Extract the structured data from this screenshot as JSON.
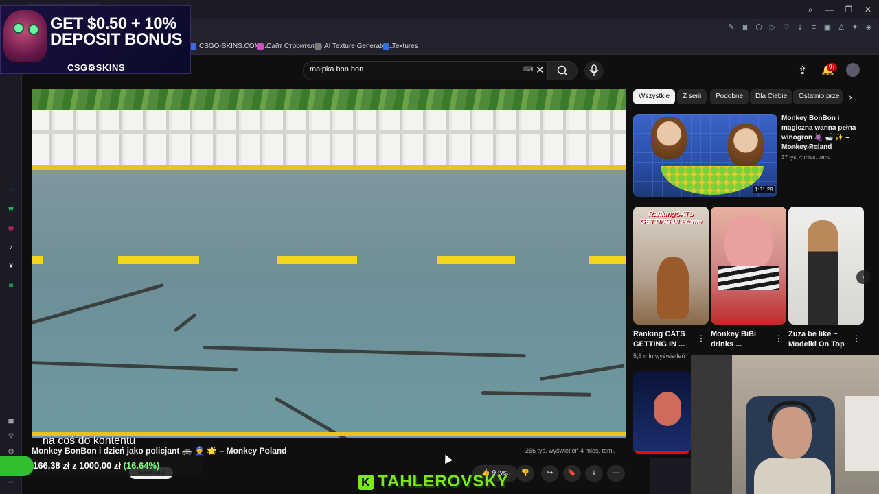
{
  "ad": {
    "headline": "GET $0.50 + 10% DEPOSIT BONUS",
    "brand": "CSG⚙SKINS"
  },
  "browser": {
    "bookmarks": [
      {
        "label": "CSGO-SKINS.COM -...",
        "color": "#3a6adf"
      },
      {
        "label": "Сайт Строителей",
        "color": "#d04fc0"
      },
      {
        "label": "AI Texture Generator...",
        "color": "#7a7a7a"
      },
      {
        "label": "Textures",
        "color": "#2f6fe0"
      }
    ],
    "window_controls": [
      "search-icon",
      "minimize-icon",
      "restore-icon",
      "close-icon"
    ]
  },
  "sidebar": {
    "apps": [
      {
        "name": "messenger",
        "color": "#2f7bff",
        "glyph": "~"
      },
      {
        "name": "whatsapp",
        "color": "#25d366",
        "glyph": "w"
      },
      {
        "name": "instagram",
        "color": "#e1306c",
        "glyph": "◎"
      },
      {
        "name": "tiktok",
        "color": "#ffffff",
        "glyph": "♪"
      },
      {
        "name": "x",
        "color": "#ffffff",
        "glyph": "X"
      },
      {
        "name": "spotify",
        "color": "#1db954",
        "glyph": "≋"
      }
    ]
  },
  "youtube": {
    "search_query": "małpka bon bon",
    "notifications_badge": "9+",
    "avatar_letter": "L",
    "chips": [
      "Wszystkie",
      "Z serii",
      "Podobne",
      "Dla Ciebie",
      "Ostatnio prze"
    ],
    "active_chip": "Wszystkie"
  },
  "video": {
    "caption": "na coś do kontentu",
    "title": "Monkey BonBon i dzień jako policjant 🚓 👮 🌟 – Monkey Poland",
    "meta": "266 tys. wyświetleń  4 mies. temu",
    "likes": "9 tys.",
    "subscribe": "Subskrybuj"
  },
  "donation": {
    "current": "166,38 zł",
    "separator": "z",
    "goal": "1000,00 zł",
    "percent_label": "(16.64%)",
    "progress": 0.1664
  },
  "streamer": {
    "name": "TAHLEROVSKY",
    "logo_letter": "K"
  },
  "recommendation": {
    "title": "Monkey BonBon i magiczna wanna pełna winogron 🍇 🛁 ✨ – Monkey Poland",
    "channel": "Monkey Poland",
    "meta": "37 tys.  4 mies. temu",
    "duration": "1:31:28"
  },
  "shorts": [
    {
      "title": "Ranking CATS GETTING IN ...",
      "overlay": "RankingCATS GETTING IN Frame",
      "views": "5,8 mln wyświetleń"
    },
    {
      "title": "Monkey BiBi drinks ..."
    },
    {
      "title": "Zuza be like ~ Modelki On Top ..."
    }
  ]
}
